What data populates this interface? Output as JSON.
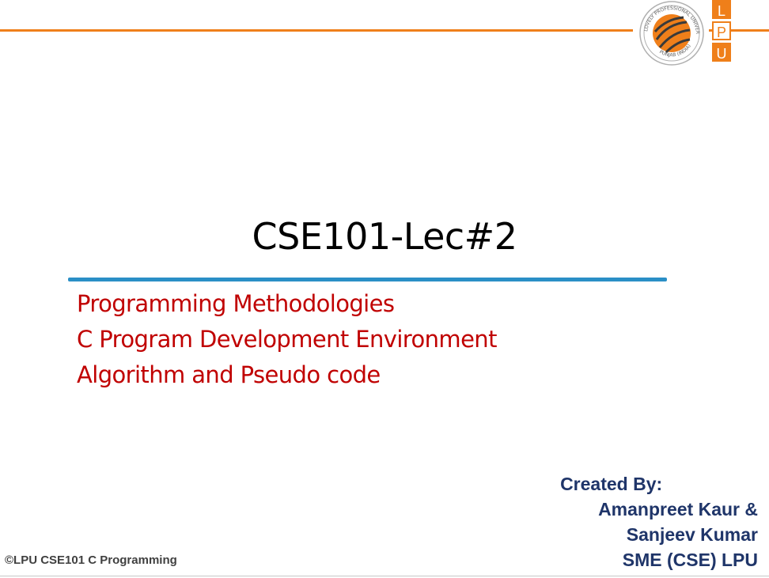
{
  "header": {
    "logo_letters": [
      "L",
      "P",
      "U"
    ],
    "seal_text_top": "LOVELY PROFESSIONAL UNIVERSITY",
    "seal_text_bottom": "PUNJAB (INDIA)"
  },
  "slide": {
    "title": "CSE101-Lec#2",
    "topics": [
      "Programming Methodologies",
      "C Program Development Environment",
      "Algorithm and Pseudo code"
    ]
  },
  "credits": {
    "label": "Created By:",
    "authors_line1": "Amanpreet Kaur &",
    "authors_line2": "Sanjeev Kumar",
    "affiliation": "SME (CSE) LPU"
  },
  "footer": {
    "copyright": "©LPU CSE101 C Programming"
  },
  "colors": {
    "accent_orange": "#ef7f1a",
    "title_rule_blue": "#2a8fc6",
    "topic_red": "#c00000",
    "credits_navy": "#1f3569"
  }
}
